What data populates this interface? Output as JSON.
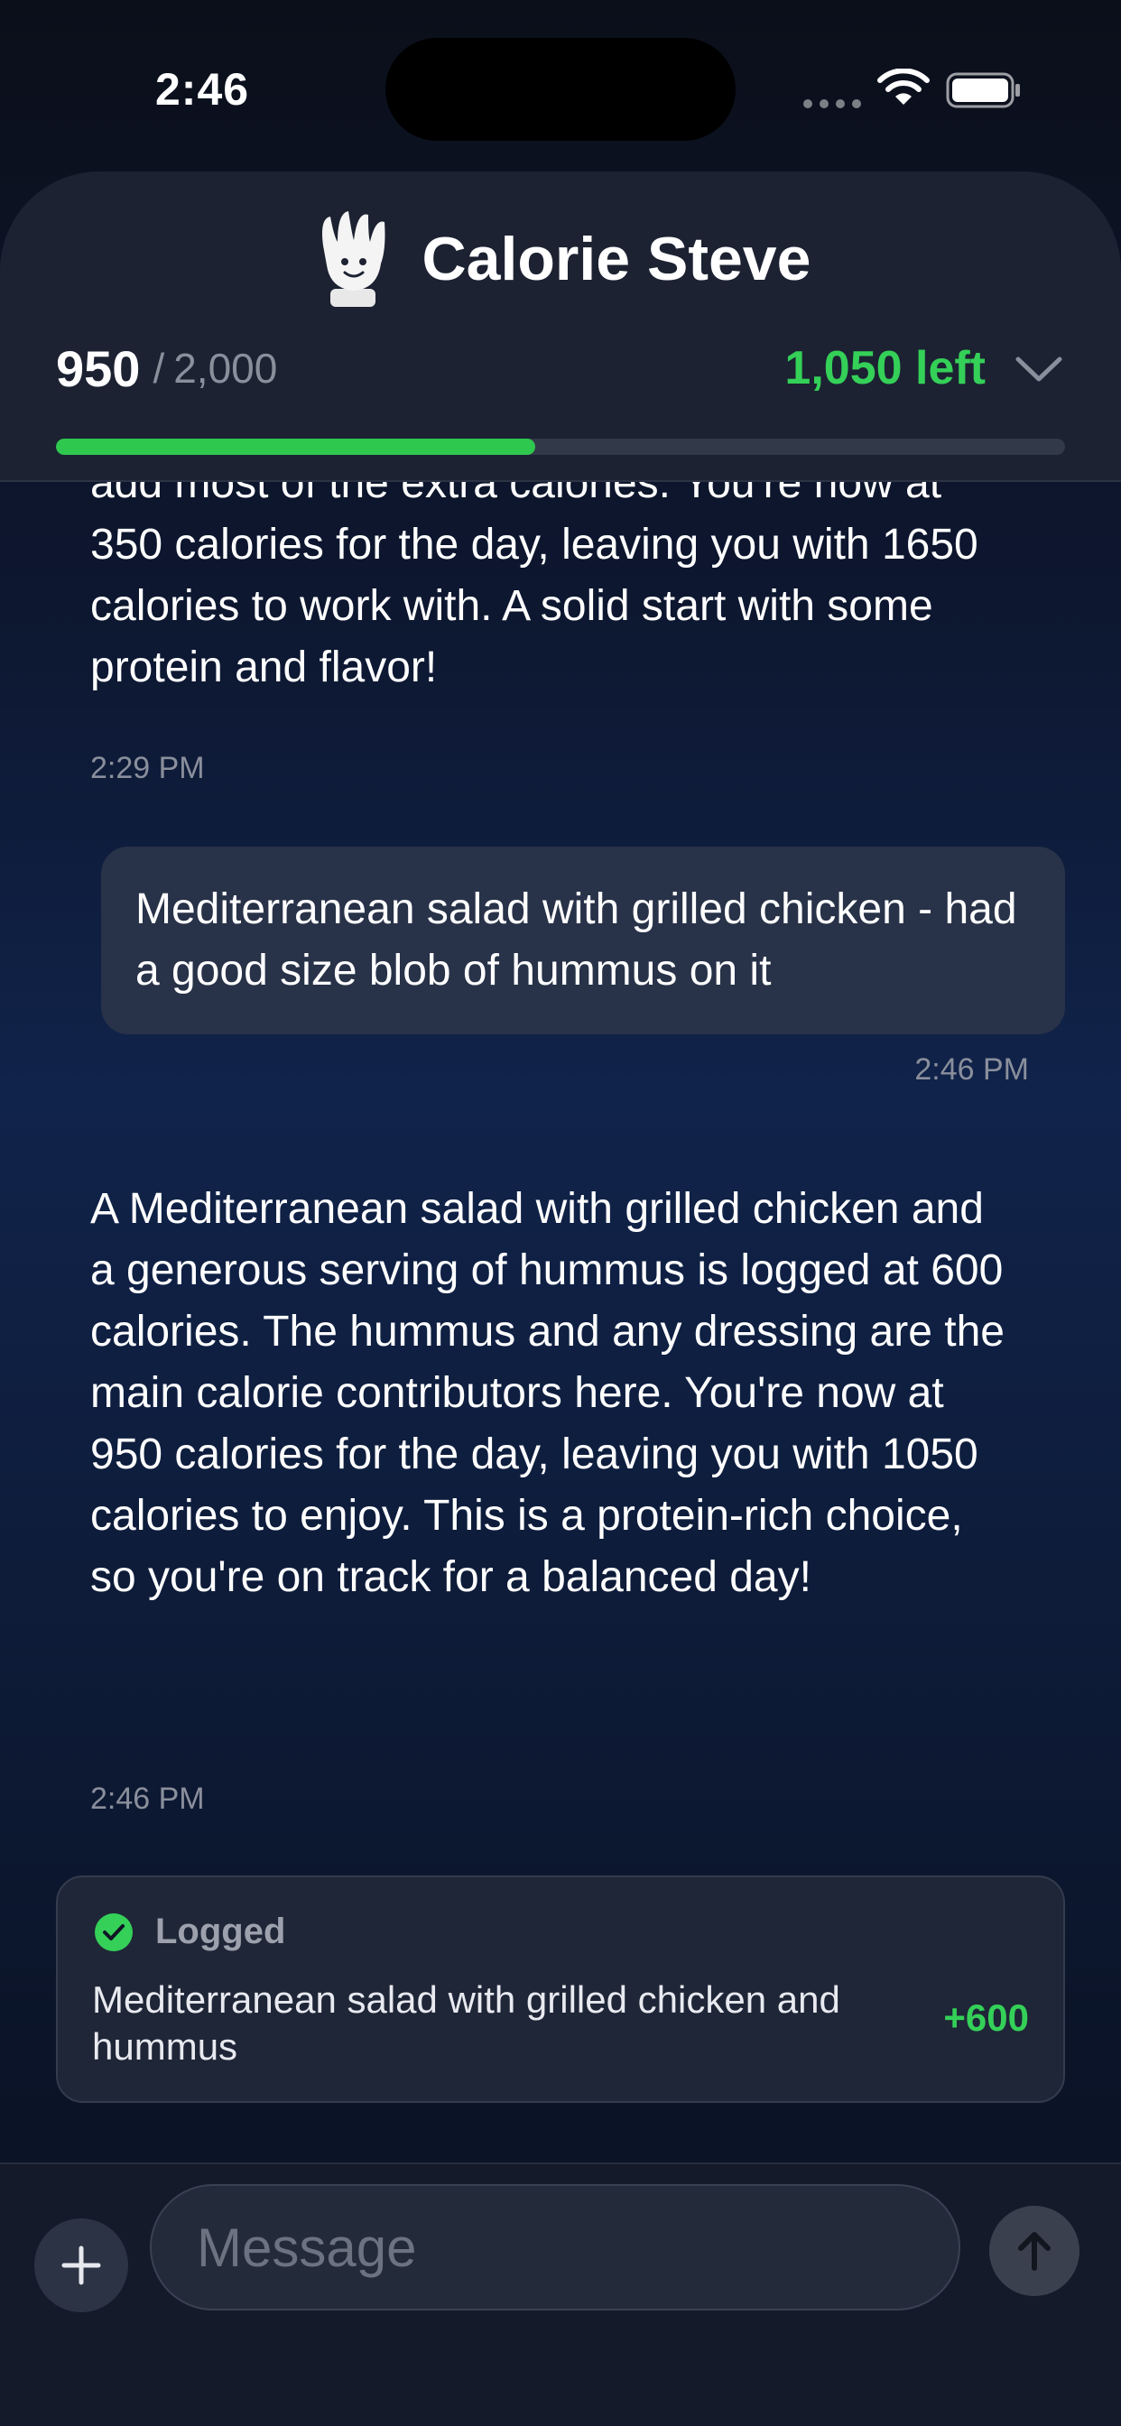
{
  "status_bar": {
    "time": "2:46"
  },
  "header": {
    "title": "Calorie Steve",
    "consumed": "950",
    "separator": "/",
    "goal": "2,000",
    "remaining": "1,050 left",
    "progress_fraction": 0.475,
    "icons": {
      "mascot": "mascot-icon",
      "expand": "chevron-down-icon"
    },
    "colors": {
      "accent": "#34d058",
      "progress": "#2fc84f"
    }
  },
  "messages": [
    {
      "role": "assistant",
      "text": "add most of the extra calories. You're now at 350 calories for the day, leaving you with 1650 calories to work with. A solid start with some protein and flavor!",
      "time": "2:29 PM"
    },
    {
      "role": "user",
      "text": "Mediterranean salad with grilled chicken - had a good size blob of hummus on it",
      "time": "2:46 PM"
    },
    {
      "role": "assistant",
      "text": "A Mediterranean salad with grilled chicken and a generous serving of hummus is logged at 600 calories. The hummus and any dressing are the main calorie contributors here. You're now at 950 calories for the day, leaving you with 1050 calories to enjoy. This is a protein-rich choice, so you're on track for a balanced day!",
      "time": "2:46 PM"
    }
  ],
  "log_card": {
    "status": "Logged",
    "description": "Mediterranean salad with grilled chicken and hummus",
    "calories": "+600"
  },
  "composer": {
    "placeholder": "Message",
    "icons": {
      "add": "plus-icon",
      "send": "arrow-up-icon"
    }
  }
}
